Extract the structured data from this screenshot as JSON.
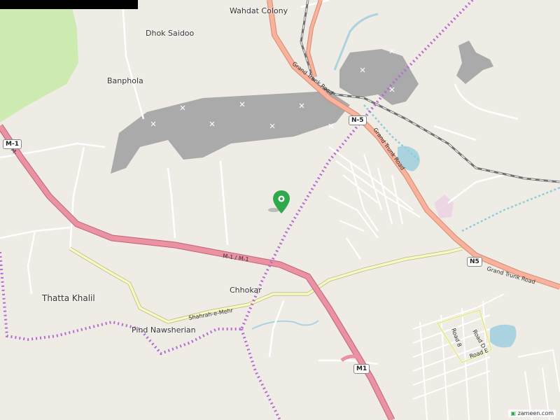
{
  "map": {
    "places": {
      "wahdat_colony": "Wahdat Colony",
      "dhok_saidoo": "Dhok Saidoo",
      "banphola": "Banphola",
      "thatta_khalil": "Thatta Khalil",
      "chhokar": "Chhokar",
      "pind_nawsherian": "Pind Nawsherian"
    },
    "roads": {
      "grand_trunk_road": "Grand Trunk Road",
      "n5": "N-5",
      "n5_shield": "N5",
      "m1": "M1",
      "m1_dash": "M-1",
      "m1_pair": "M-1 / M-1",
      "m1_fragment": "M-",
      "shahrah_e_mehr": "Shahrah-e-Mehr",
      "road_8": "Road 8",
      "road_d": "Road D",
      "road_e": "Road E"
    },
    "watermark": "zameen.com",
    "colors": {
      "background": "#efece6",
      "motorway": "#e892a2",
      "trunk": "#f9b29c",
      "secondary": "#f7fabf",
      "forest": "#cdebb0",
      "quarry": "#aaaaaa",
      "water": "#aad3df",
      "boundary": "#ac46ac",
      "pin": "#2ea94c"
    },
    "icons": {
      "pin": "location-pin-icon",
      "quarry": "quarry-pickaxe-icon"
    }
  }
}
